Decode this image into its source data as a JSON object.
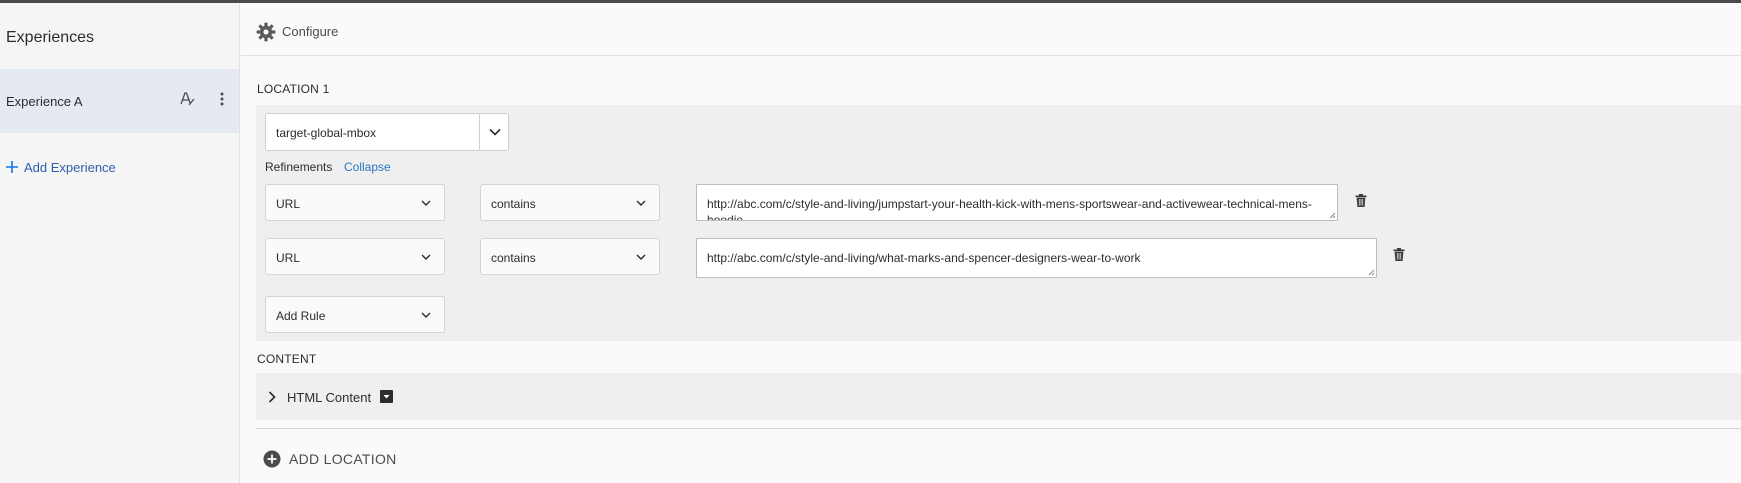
{
  "sidebar": {
    "title": "Experiences",
    "experiences": [
      {
        "label": "Experience A"
      }
    ],
    "add_experience_label": "Add Experience"
  },
  "header": {
    "configure_label": "Configure"
  },
  "location": {
    "title": "LOCATION 1",
    "mbox_value": "target-global-mbox",
    "refinements_label": "Refinements",
    "collapse_label": "Collapse",
    "rules": [
      {
        "field": "URL",
        "operator": "contains",
        "value": "http://abc.com/c/style-and-living/jumpstart-your-health-kick-with-mens-sportswear-and-activewear-technical-mens-hoodie"
      },
      {
        "field": "URL",
        "operator": "contains",
        "value": "http://abc.com/c/style-and-living/what-marks-and-spencer-designers-wear-to-work"
      }
    ],
    "add_rule_label": "Add Rule"
  },
  "content": {
    "title": "CONTENT",
    "html_content_label": "HTML Content"
  },
  "add_location_label": "ADD LOCATION",
  "icons": {
    "gear": "gear-icon",
    "rename": "rename-icon",
    "more": "more-vertical-icon",
    "plus": "plus-icon",
    "chevron": "chevron-down-icon",
    "trash": "trash-icon",
    "add_circle": "add-circle-icon"
  },
  "colors": {
    "accent": "#1473e6",
    "link": "#2d73c4",
    "selected_item_bg": "#e5e9f1"
  }
}
